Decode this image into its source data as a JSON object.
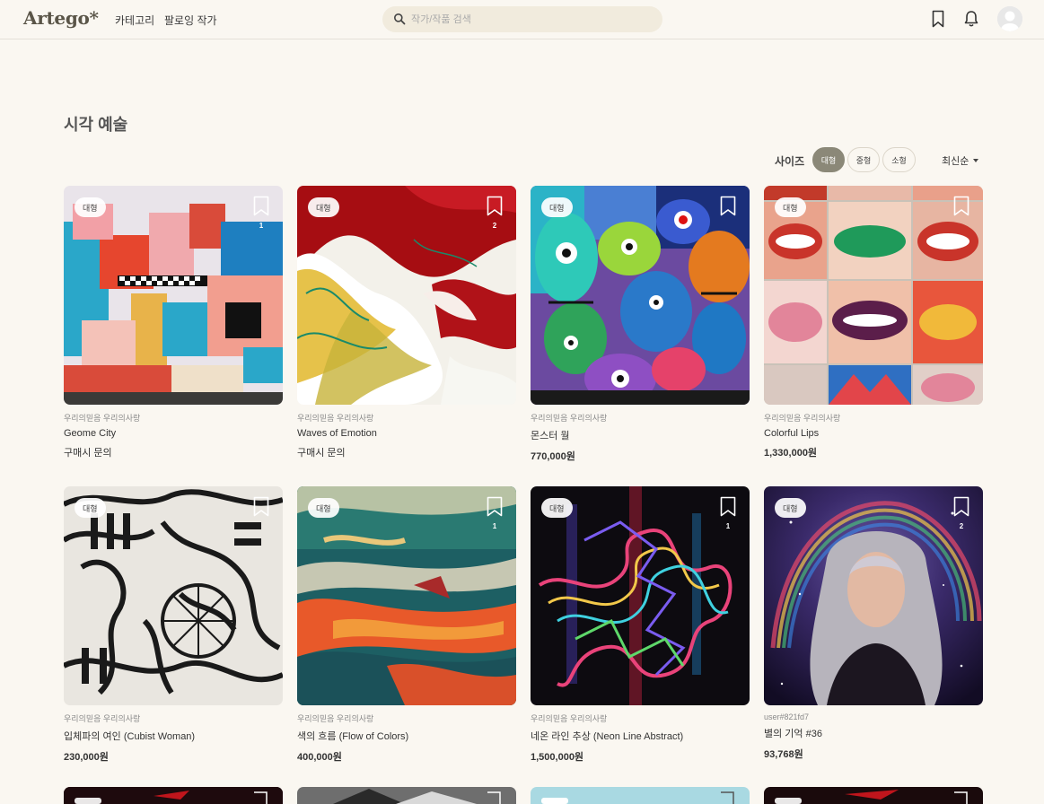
{
  "header": {
    "logo": "Artego*",
    "nav": [
      "카테고리",
      "팔로잉 작가"
    ],
    "search_placeholder": "작가/작품 검색"
  },
  "page": {
    "title": "시각 예술"
  },
  "filters": {
    "size_label": "사이즈",
    "sizes": [
      {
        "label": "대형",
        "active": true
      },
      {
        "label": "중형",
        "active": false
      },
      {
        "label": "소형",
        "active": false
      }
    ],
    "sort_label": "최신순"
  },
  "artworks": [
    {
      "badge": "대형",
      "bookmarks": "1",
      "artist": "우리의믿음 우리의사랑",
      "title": "Geome City",
      "price": "구매시 문의"
    },
    {
      "badge": "대형",
      "bookmarks": "2",
      "artist": "우리의믿음 우리의사랑",
      "title": "Waves of Emotion",
      "price": "구매시 문의"
    },
    {
      "badge": "대형",
      "bookmarks": "",
      "artist": "우리의믿음 우리의사랑",
      "title": "몬스터 월",
      "price": "770,000원"
    },
    {
      "badge": "대형",
      "bookmarks": "",
      "artist": "우리의믿음 우리의사랑",
      "title": "Colorful Lips",
      "price": "1,330,000원"
    },
    {
      "badge": "대형",
      "bookmarks": "",
      "artist": "우리의믿음 우리의사랑",
      "title": "입체파의 여인 (Cubist Woman)",
      "price": "230,000원"
    },
    {
      "badge": "대형",
      "bookmarks": "1",
      "artist": "우리의믿음 우리의사랑",
      "title": "색의 흐름 (Flow of Colors)",
      "price": "400,000원"
    },
    {
      "badge": "대형",
      "bookmarks": "1",
      "artist": "우리의믿음 우리의사랑",
      "title": "네온 라인 추상 (Neon Line Abstract)",
      "price": "1,500,000원"
    },
    {
      "badge": "대형",
      "bookmarks": "2",
      "artist": "user#821fd7",
      "title": "별의 기억 #36",
      "price": "93,768원"
    }
  ]
}
